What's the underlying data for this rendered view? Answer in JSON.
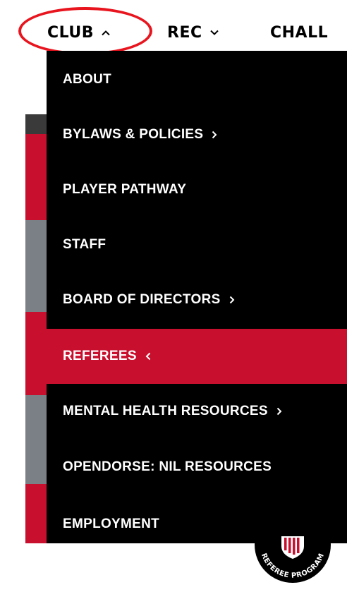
{
  "nav": {
    "items": [
      {
        "label": "CLUB",
        "icon": "chevron-up-icon"
      },
      {
        "label": "REC",
        "icon": "chevron-down-icon"
      },
      {
        "label": "CHALL"
      }
    ]
  },
  "dropdown": {
    "items": [
      {
        "label": "ABOUT"
      },
      {
        "label": "BYLAWS & POLICIES",
        "icon": "chevron-right-icon"
      },
      {
        "label": "PLAYER PATHWAY"
      },
      {
        "label": "STAFF"
      },
      {
        "label": "BOARD OF DIRECTORS",
        "icon": "chevron-right-icon"
      },
      {
        "label": "REFEREES",
        "icon": "chevron-left-icon",
        "active": true
      },
      {
        "label": "MENTAL HEALTH RESOURCES",
        "icon": "chevron-right-icon"
      },
      {
        "label": "OPENDORSE: NIL RESOURCES"
      },
      {
        "label": "EMPLOYMENT"
      }
    ]
  },
  "badge": {
    "text": "REFEREE PROGRAM"
  },
  "colors": {
    "accent_red": "#c8102e",
    "annotation_ring": "#e8141e",
    "menu_bg": "#000000",
    "stripe_gray": "#7b7f86"
  }
}
